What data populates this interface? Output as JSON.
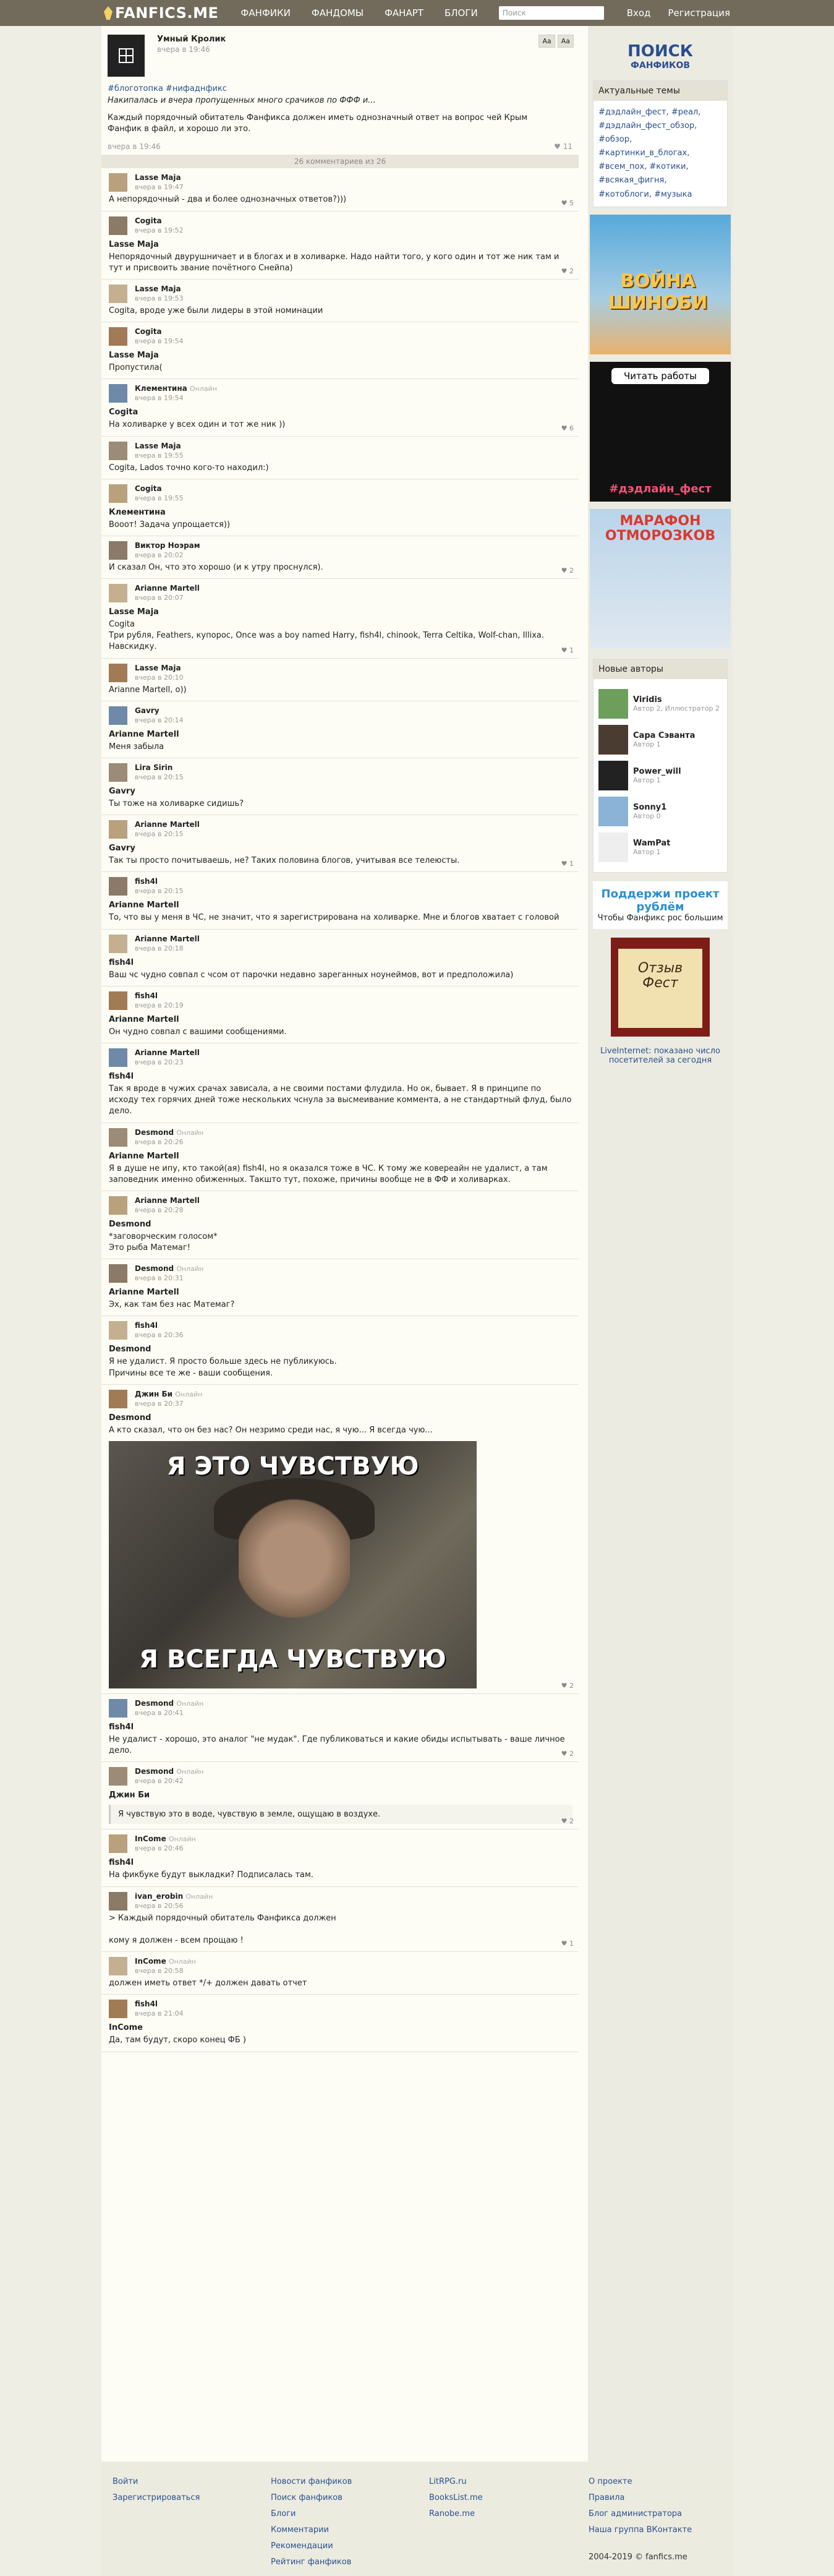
{
  "header": {
    "logo": "FANFICS.ME",
    "nav": [
      "ФАНФИКИ",
      "ФАНДОМЫ",
      "ФАНАРТ",
      "БЛОГИ"
    ],
    "search_placeholder": "Поиск",
    "right": [
      "Вход",
      "Регистрация"
    ]
  },
  "post": {
    "author": "Умный Кролик",
    "date": "вчера в 19:46",
    "tags": "#блоготопка #нифаднфикс",
    "intro": "Накипалась и вчера пропущенных много срачиков по ФФФ и...",
    "text": "Каждый порядочный обитатель Фанфикса должен иметь однозначный ответ на вопрос чей Крым Фанфик в файл, и хорошо ли это.",
    "footer_date": "вчера в 19:46",
    "likes": "11"
  },
  "divider": "26 комментариев из 26",
  "comments": [
    {
      "name": "Lasse Maja",
      "date": "вчера в 19:47",
      "quote": "",
      "text": "А непорядочный - два и более однозначных ответов?)))",
      "likes": "5"
    },
    {
      "name": "Cogita",
      "date": "вчера в 19:52",
      "quote": "Lasse Maja",
      "text": "Непорядочный двурушничает и в блогах и в холиварке. Надо найти того, у кого один и тот же ник там и тут и присвоить звание почётного Снейпа)",
      "likes": "2"
    },
    {
      "name": "Lasse Maja",
      "date": "вчера в 19:53",
      "quote": "",
      "text": "Cogita, вроде уже были лидеры в этой номинации",
      "likes": ""
    },
    {
      "name": "Cogita",
      "date": "вчера в 19:54",
      "quote": "Lasse Maja",
      "text": "Пропустила(",
      "likes": ""
    },
    {
      "name": "Клементина",
      "online": "Онлайн",
      "date": "вчера в 19:54",
      "quote": "Cogita",
      "text": "На холиварке у всех один и тот же ник ))",
      "likes": "6"
    },
    {
      "name": "Lasse Maja",
      "date": "вчера в 19:55",
      "quote": "",
      "text": "Cogita, Lados точно кого-то находил:)",
      "likes": ""
    },
    {
      "name": "Cogita",
      "date": "вчера в 19:55",
      "quote": "Клементина",
      "text": "Вооот! Задача упрощается))",
      "likes": ""
    },
    {
      "name": "Виктор Ноэрам",
      "date": "вчера в 20:02",
      "quote": "",
      "text": "И сказал Он, что это хорошо (и к утру проснулся).",
      "likes": "2"
    },
    {
      "name": "Arianne Martell",
      "date": "вчера в 20:07",
      "quote": "Lasse Maja",
      "text": "Cogita\nТри рубля, Feathers, купорос, Once was a boy named Harry, fish4l, chinook, Terra Celtika, Wolf-chan, Illixa.\nНавскидку.",
      "likes": "1"
    },
    {
      "name": "Lasse Maja",
      "date": "вчера в 20:10",
      "quote": "",
      "text": "Arianne Martell, о))",
      "likes": ""
    },
    {
      "name": "Gavry",
      "date": "вчера в 20:14",
      "quote": "Arianne Martell",
      "text": "Меня забыла",
      "likes": ""
    },
    {
      "name": "Lira Sirin",
      "date": "вчера в 20:15",
      "quote": "Gavry",
      "text": "Ты тоже на холиварке сидишь?",
      "likes": ""
    },
    {
      "name": "Arianne Martell",
      "date": "вчера в 20:15",
      "quote": "Gavry",
      "text": "Так ты просто почитываешь, не? Таких половина блогов, учитывая все телеюсты.",
      "likes": "1"
    },
    {
      "name": "fish4l",
      "date": "вчера в 20:15",
      "quote": "Arianne Martell",
      "text": "То, что вы у меня в ЧС, не значит, что я зарегистрирована на холиварке. Мне и блогов хватает с головой",
      "likes": ""
    },
    {
      "name": "Arianne Martell",
      "date": "вчера в 20:18",
      "quote": "fish4l",
      "text": "Ваш чс чудно совпал с чсом от парочки недавно зареганных ноунеймов, вот и предположила)",
      "likes": ""
    },
    {
      "name": "fish4l",
      "date": "вчера в 20:19",
      "quote": "Arianne Martell",
      "text": "Он чудно совпал с вашими сообщениями.",
      "likes": ""
    },
    {
      "name": "Arianne Martell",
      "date": "вчера в 20:23",
      "quote": "fish4l",
      "text": "Так я вроде в чужих срачах зависала, а не своими постами флудила. Но ок, бывает. Я в принципе по исходу тех горячих дней тоже нескольких чснула за высмеивание коммента, а не стандартный флуд, было дело.",
      "likes": ""
    },
    {
      "name": "Desmond",
      "online": "Онлайн",
      "date": "вчера в 20:26",
      "quote": "Arianne Martell",
      "text": "Я в душе не ипу, кто такой(ая) fish4l, но я оказался тоже в ЧС. К тому же ковереайн не удалист, а там заповедник именно обиженных. Такшто тут, похоже, причины вообще не в ФФ и холиварках.",
      "likes": ""
    },
    {
      "name": "Arianne Martell",
      "date": "вчера в 20:28",
      "quote": "Desmond",
      "text": "*заговорческим голосом*\nЭто рыба Матемаг!",
      "likes": ""
    },
    {
      "name": "Desmond",
      "online": "Онлайн",
      "date": "вчера в 20:31",
      "quote": "Arianne Martell",
      "text": "Эх, как там без нас Матемаг?",
      "likes": ""
    },
    {
      "name": "fish4l",
      "date": "вчера в 20:36",
      "quote": "Desmond",
      "text": "Я не удалист. Я просто больше здесь не публикуюсь.\nПричины все те же - ваши сообщения.",
      "likes": ""
    },
    {
      "name": "Джин Би",
      "online": "Онлайн",
      "date": "вчера в 20:37",
      "quote": "Desmond",
      "text": "А кто сказал, что он без нас? Он незримо среди нас, я чую... Я всегда чую...",
      "likes": "2",
      "meme_top": "Я ЭТО ЧУВСТВУЮ",
      "meme_bottom": "Я ВСЕГДА ЧУВСТВУЮ"
    },
    {
      "name": "Desmond",
      "online": "Онлайн",
      "date": "вчера в 20:41",
      "quote": "fish4l",
      "text": "Не удалист - хорошо, это аналог \"не мудак\". Где публиковаться и какие обиды испытывать - ваше личное дело.",
      "likes": "2"
    },
    {
      "name": "Desmond",
      "online": "Онлайн",
      "date": "вчера в 20:42",
      "quote": "Джин Би",
      "text": "Я чувствую это в воде, чувствую в земле, ощущаю в воздухе.",
      "likes": "2"
    },
    {
      "name": "InCome",
      "online": "Онлайн",
      "date": "вчера в 20:46",
      "quote": "fish4l",
      "text": "На фикбуке будут выкладки? Подписалась там.",
      "likes": ""
    },
    {
      "name": "ivan_erobin",
      "online": "Онлайн",
      "date": "вчера в 20:56",
      "quote": "",
      "text": "> Каждый порядочный обитатель Фанфикса должен\n\nкому я должен - всем прощаю !",
      "likes": "1"
    },
    {
      "name": "InCome",
      "online": "Онлайн",
      "date": "вчера в 20:58",
      "quote": "",
      "text": "должен иметь ответ */+ должен давать отчет",
      "likes": ""
    },
    {
      "name": "fish4l",
      "date": "вчера в 21:04",
      "quote": "InCome",
      "text": "Да, там будут, скоро конец ФБ )",
      "likes": ""
    }
  ],
  "sidebar": {
    "search_title": "ПОИСК",
    "search_sub": "ФАНФИКОВ",
    "topics_title": "Актуальные темы",
    "topics": "#дэдлайн_фест, #реал, #дэдлайн_фест_обзор, #обзор, #картинки_в_блогах, #всем_пох, #котики, #всякая_фигня, #котоблоги, #музыка",
    "banner1": "ВОЙНА ШИНОБИ",
    "banner2_title": "Читать работы",
    "banner2_tag": "#дэдлайн_фест",
    "banner3": "МАРАФОН ОТМОРОЗКОВ",
    "authors_title": "Новые авторы",
    "authors": [
      {
        "name": "Viridis",
        "sub": "Автор 2, Иллюстратор 2"
      },
      {
        "name": "Сара Сэванта",
        "sub": "Автор 1"
      },
      {
        "name": "Power_will",
        "sub": "Автор 1"
      },
      {
        "name": "Sonny1",
        "sub": "Автор 0"
      },
      {
        "name": "WamPat",
        "sub": "Автор 1"
      }
    ],
    "support_title": "Поддержи проект рублём",
    "support_sub": "Чтобы Фанфикс рос большим",
    "book": "Отзыв Фест",
    "liveinternet": "LiveInternet: показано число посетителей за сегодня"
  },
  "footer": {
    "col1": [
      "Войти",
      "Зарегистрироваться"
    ],
    "col2": [
      "Новости фанфиков",
      "Поиск фанфиков",
      "Блоги",
      "Комментарии",
      "Рекомендации",
      "Рейтинг фанфиков"
    ],
    "col3": [
      "LitRPG.ru",
      "BooksList.me",
      "Ranobe.me"
    ],
    "col4": [
      "О проекте",
      "Правила",
      "Блог администратора",
      "Наша группа ВКонтакте"
    ],
    "copyright": "2004-2019 © fanfics.me"
  }
}
